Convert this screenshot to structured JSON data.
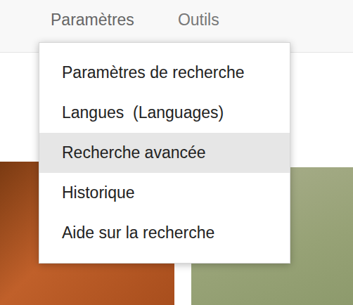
{
  "toolbar": {
    "items": [
      {
        "label": "Paramètres",
        "expanded": true
      },
      {
        "label": "Outils",
        "expanded": false
      }
    ]
  },
  "menu": {
    "items": [
      {
        "label": "Paramètres de recherche",
        "selected": false
      },
      {
        "label": "Langues  (Languages)",
        "selected": false
      },
      {
        "label": "Recherche avancée",
        "selected": true
      },
      {
        "label": "Historique",
        "selected": false
      },
      {
        "label": "Aide sur la recherche",
        "selected": false
      }
    ]
  }
}
